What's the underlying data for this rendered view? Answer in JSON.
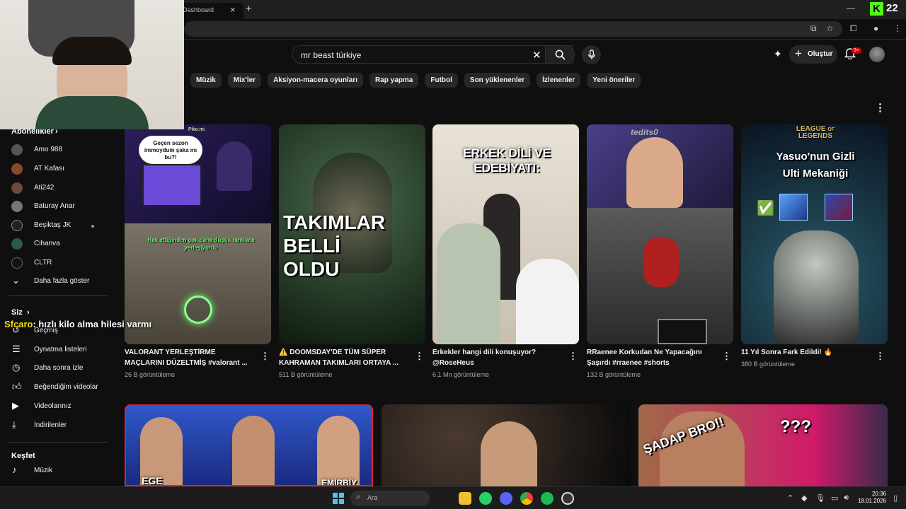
{
  "browser": {
    "tab_title": "Dashboard",
    "tab_close": "×",
    "new_tab": "+",
    "minimize": "—",
    "kick_badge": "K",
    "kick_count": "22"
  },
  "masthead": {
    "search_value": "mr beast türkiye",
    "clear": "✕",
    "create_label": "Oluştur",
    "notification_badge": "9+"
  },
  "chips": [
    "Müzik",
    "Mix'ler",
    "Aksiyon-macera oyunları",
    "Rap yapma",
    "Futbol",
    "Son yüklenenler",
    "İzlenenler",
    "Yeni öneriler"
  ],
  "sidebar": {
    "subscriptions_heading": "Abonelikler",
    "subscriptions": [
      {
        "label": "Amo 988",
        "color": "#555"
      },
      {
        "label": "AT Kafası",
        "color": "#8a4a2a"
      },
      {
        "label": "Ati242",
        "color": "#6b4a3a"
      },
      {
        "label": "Baturay Anar",
        "color": "#777"
      },
      {
        "label": "Beşiktaş JK",
        "color": "#222"
      },
      {
        "label": "Cihanva",
        "color": "#2a5a4a"
      },
      {
        "label": "CLTR",
        "color": "#111"
      }
    ],
    "show_more": "Daha fazla göster",
    "you_heading": "Siz",
    "you_items": [
      {
        "label": "Geçmiş",
        "icon": "history-icon"
      },
      {
        "label": "Oynatma listeleri",
        "icon": "playlist-icon"
      },
      {
        "label": "Daha sonra izle",
        "icon": "clock-icon"
      },
      {
        "label": "Beğendiğim videolar",
        "icon": "like-icon"
      },
      {
        "label": "Videolarınız",
        "icon": "video-icon"
      },
      {
        "label": "İndirilenler",
        "icon": "download-icon"
      }
    ],
    "explore_heading": "Keşfet",
    "explore_items": [
      {
        "label": "Müzik",
        "icon": "music-icon"
      }
    ]
  },
  "chat_overlay": {
    "user": "Sfcaro",
    "message": ": hızlı kilo alma hilesi varmı"
  },
  "videos": [
    {
      "title1": "VALORANT YERLEŞTİRME",
      "title2": "MAÇLARINI DÜZELTMİŞ #valorant ...",
      "meta": "26 B görüntüleme",
      "bubble": "Geçen sezon immoydum şaka mı bu?!",
      "caption": "Hak ettiğinden çok daha düşük ranklara yerleşiyordu",
      "watermark": "Piko.mi"
    },
    {
      "title1": "⚠️ DOOMSDAY'DE TÜM SÜPER",
      "title2": "KAHRAMAN TAKIMLARI ORTAYA ...",
      "meta": "511 B görüntüleme",
      "overlay": [
        "TAKIMLAR",
        "BELLİ",
        "OLDU"
      ]
    },
    {
      "title1": "Erkekler hangi dili konuşuyor?",
      "title2": "@RoseHeus",
      "meta": "6,1 Mn görüntüleme",
      "overlay": [
        "ERKEK DİLİ VE",
        "EDEBİYATI:"
      ]
    },
    {
      "title1": "RRaenee Korkudan Ne Yapacağını",
      "title2": "Şaşırdı #rraenee #shorts",
      "meta": "132 B görüntüleme",
      "watermark": "tedits0"
    },
    {
      "title1": "11 Yıl Sonra Fark Edildi! 🔥",
      "title2": "",
      "meta": "380 B görüntüleme",
      "logo": [
        "LEAGUE",
        "OF",
        "LEGENDS"
      ],
      "overlay": [
        "Yasuo'nun Gizli",
        "Ulti Mekaniği"
      ],
      "check": "✅"
    }
  ],
  "row2": {
    "ege": "EGE",
    "emir": "EMİRBİY",
    "sadap": "ŞADAP BRO!!",
    "qqq": "???"
  },
  "taskbar": {
    "search_label": "Ara",
    "time": "20:36",
    "date": "18.01.2026"
  }
}
